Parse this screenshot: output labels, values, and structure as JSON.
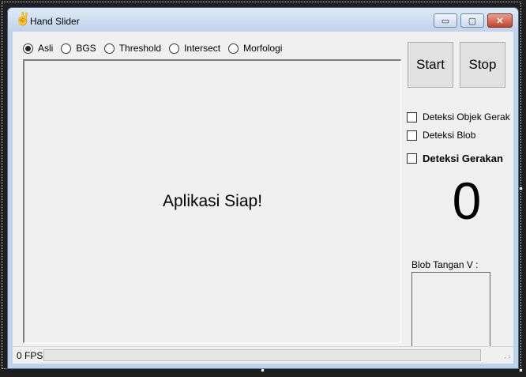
{
  "window": {
    "title": "Hand Slider",
    "icon": "victory-hand-icon"
  },
  "caption_buttons": {
    "minimize": "▭",
    "maximize": "▢",
    "close": "✕"
  },
  "view_options": [
    {
      "label": "Asli",
      "selected": true
    },
    {
      "label": "BGS",
      "selected": false
    },
    {
      "label": "Threshold",
      "selected": false
    },
    {
      "label": "Intersect",
      "selected": false
    },
    {
      "label": "Morfologi",
      "selected": false
    }
  ],
  "video_panel": {
    "message": "Aplikasi Siap!"
  },
  "buttons": {
    "start": "Start",
    "stop": "Stop"
  },
  "options": {
    "detect_object_motion": {
      "label": "Deteksi Objek Gerak",
      "checked": false
    },
    "detect_blob": {
      "label": "Deteksi Blob",
      "checked": false
    },
    "detect_gesture": {
      "label": "Deteksi Gerakan",
      "checked": false
    }
  },
  "gesture_count": "0",
  "blob_panel": {
    "label": "Blob Tangan V :"
  },
  "status": {
    "fps": "0 FPS",
    "progress": 0
  },
  "colors": {
    "titlebar": "#bfd3ea",
    "client": "#f0f0f0",
    "close_button": "#c0432c"
  }
}
